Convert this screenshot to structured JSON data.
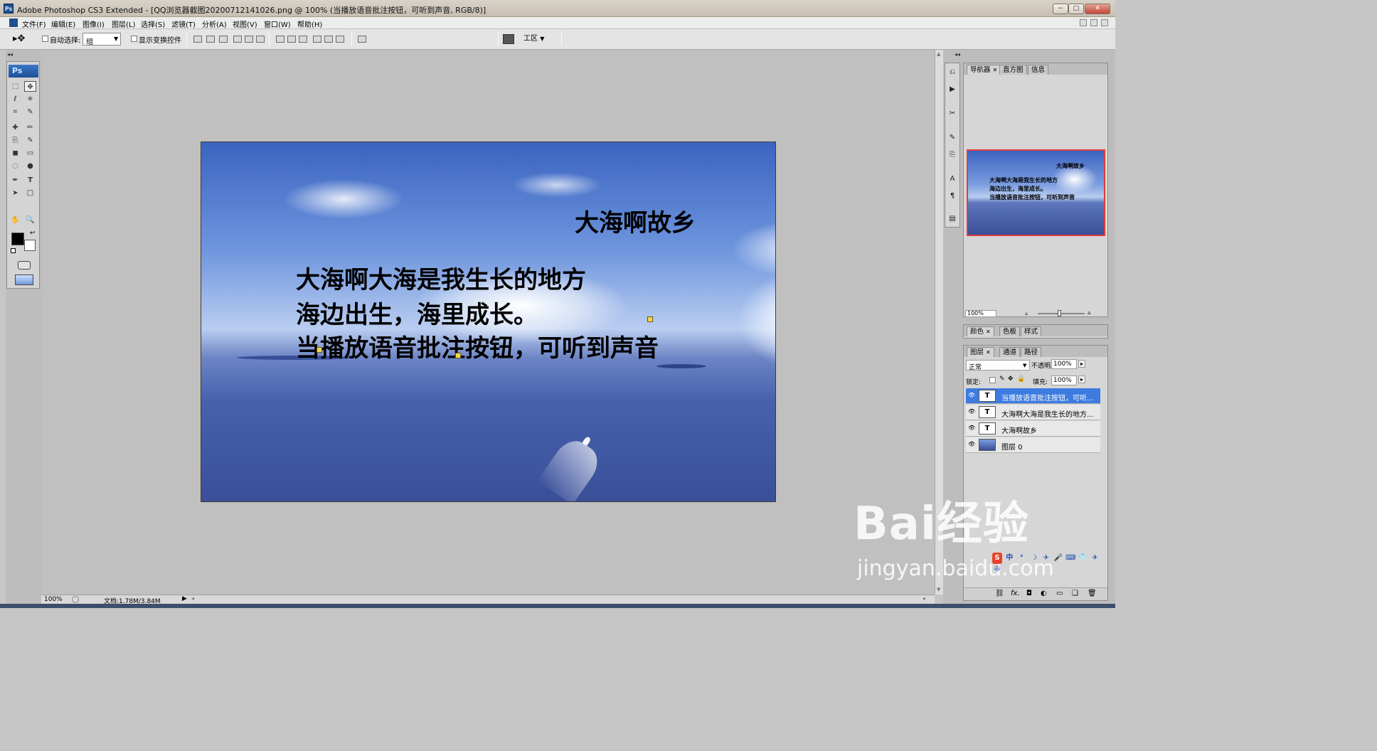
{
  "window": {
    "title": "Adobe Photoshop CS3 Extended - [QQ浏览器截图20200712141026.png @ 100% (当播放语音批注按钮，可听到声音, RGB/8)]",
    "app_icon": "Ps",
    "min_glyph": "−",
    "max_glyph": "□",
    "close_glyph": "✕"
  },
  "menubar": {
    "items": [
      "文件(F)",
      "编辑(E)",
      "图像(I)",
      "图层(L)",
      "选择(S)",
      "滤镜(T)",
      "分析(A)",
      "视图(V)",
      "窗口(W)",
      "帮助(H)"
    ]
  },
  "options": {
    "auto_select_label": "自动选择:",
    "auto_select_value": "组",
    "show_transform_label": "显示变换控件",
    "workspace_label": "工区"
  },
  "toolbox": {
    "logo": "Ps",
    "tools": [
      "⬚",
      "✥",
      "ℓ",
      "✳",
      "⌗",
      "✎",
      "✚",
      "✏",
      "⎘",
      "✎",
      "◼",
      "▭",
      "◌",
      "●",
      "✒",
      "T",
      "➤",
      "□",
      "✋",
      "🔍"
    ]
  },
  "canvas": {
    "title_text": "大海啊故乡",
    "lines": [
      "大海啊大海是我生长的地方",
      "海边出生，海里成长。",
      "当播放语音批注按钮，可听到声音"
    ]
  },
  "status": {
    "zoom": "100%",
    "doc": "文档:1.78M/3.84M"
  },
  "navigator": {
    "tabs": [
      "导航器",
      "直方图",
      "信息"
    ],
    "zoom": "100%"
  },
  "color_panel": {
    "tabs": [
      "颜色",
      "色板",
      "样式"
    ]
  },
  "layers_panel": {
    "tabs": [
      "图层",
      "通道",
      "路径"
    ],
    "blend_mode": "正常",
    "opacity_label": "不透明度:",
    "opacity_value": "100%",
    "lock_label": "锁定:",
    "fill_label": "填充:",
    "fill_value": "100%",
    "layers": [
      {
        "name": "当播放语音批注按钮，可听...",
        "type": "T",
        "selected": true
      },
      {
        "name": "大海啊大海是我生长的地方...",
        "type": "T",
        "selected": false
      },
      {
        "name": "大海啊故乡",
        "type": "T",
        "selected": false
      },
      {
        "name": "图层 0",
        "type": "image",
        "selected": false
      }
    ]
  },
  "watermark": {
    "brand": "Bai经验",
    "url": "jingyan.baidu.com"
  },
  "ime": {
    "items": [
      "S",
      "中",
      "°",
      "☽",
      "✈",
      "🎤",
      "⌨",
      "👕",
      "✈",
      "✇"
    ]
  }
}
